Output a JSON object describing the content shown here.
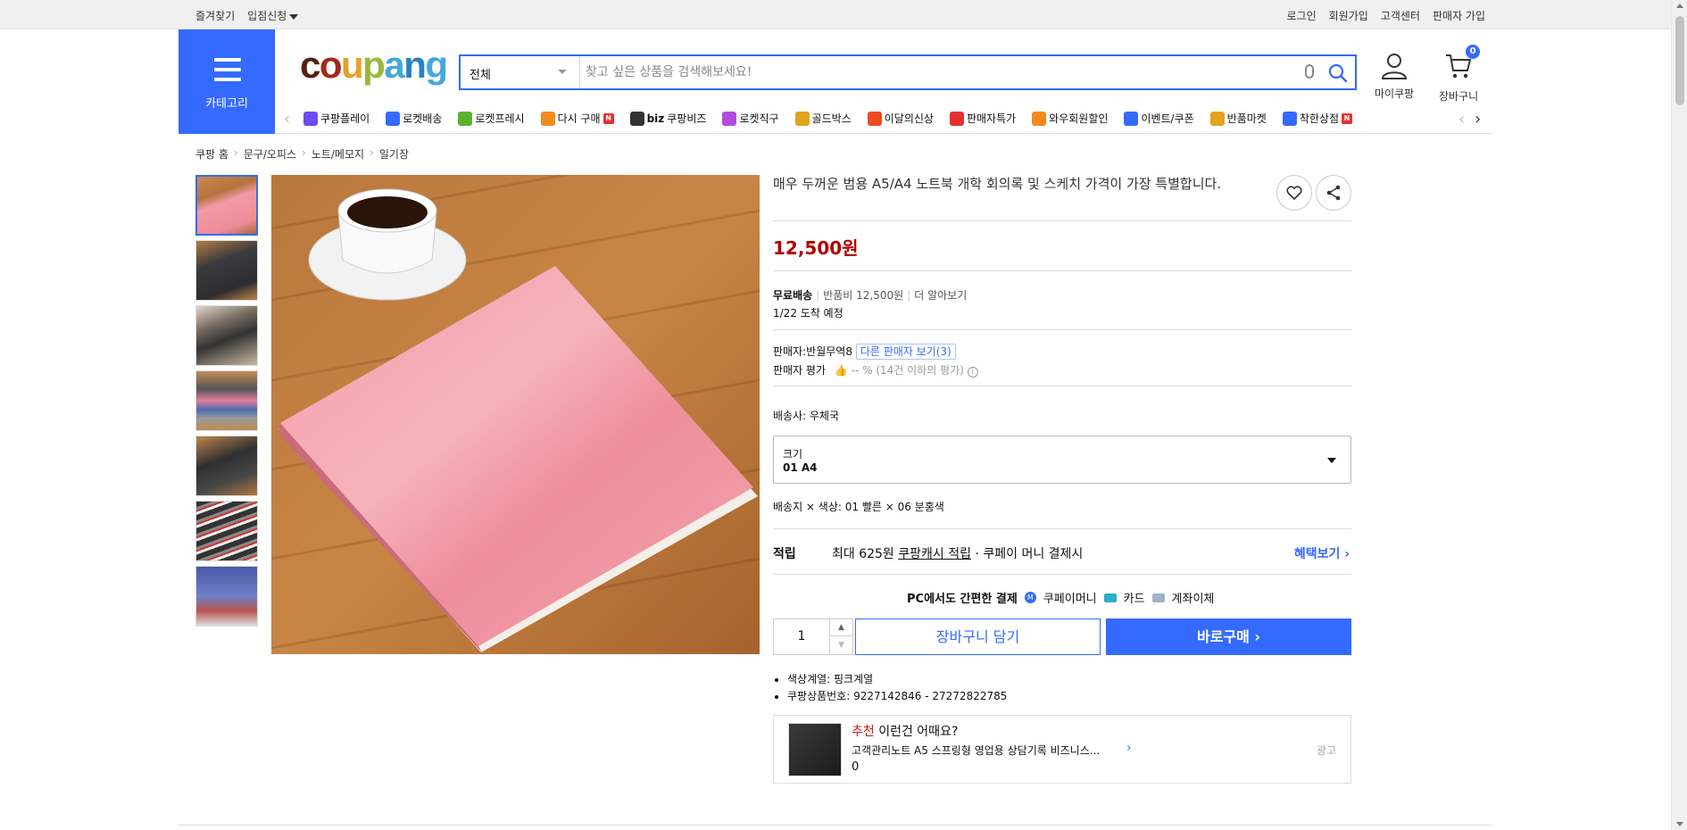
{
  "topbar": {
    "left": [
      "즐겨찾기",
      "입점신청"
    ],
    "right": [
      "로그인",
      "회원가입",
      "고객센터",
      "판매자 가입"
    ]
  },
  "header": {
    "category_label": "카테고리",
    "logo": [
      "c",
      "o",
      "u",
      "p",
      "a",
      "n",
      "g"
    ],
    "search": {
      "category": "전체",
      "placeholder": "찾고 싶은 상품을 검색해보세요!"
    },
    "mycoupang_label": "마이쿠팡",
    "cart_label": "장바구니",
    "cart_count": "0"
  },
  "nav": {
    "items": [
      {
        "label": "쿠팡플레이",
        "icon": "play-icon",
        "color": "#6b4cf6"
      },
      {
        "label": "로켓배송",
        "icon": "rocket-icon",
        "color": "#346aff"
      },
      {
        "label": "로켓프레시",
        "icon": "rocket-fresh-icon",
        "color": "#5ab22f"
      },
      {
        "label": "다시 구매",
        "icon": "rebuy-icon",
        "color": "#f28b1d",
        "badge": "N"
      },
      {
        "label": "쿠팡비즈",
        "prefix": "biz",
        "icon": "biz-icon",
        "color": "#333333"
      },
      {
        "label": "로켓직구",
        "icon": "global-rocket-icon",
        "color": "#b14ce0"
      },
      {
        "label": "골드박스",
        "icon": "goldbox-icon",
        "color": "#e0a41d"
      },
      {
        "label": "이달의신상",
        "icon": "new-icon",
        "color": "#f04a24"
      },
      {
        "label": "판매자특가",
        "icon": "percent-icon",
        "color": "#e5302e"
      },
      {
        "label": "와우회원할인",
        "icon": "wow-icon",
        "color": "#f28b1d"
      },
      {
        "label": "이벤트/쿠폰",
        "icon": "coupon-icon",
        "color": "#346aff"
      },
      {
        "label": "반품마켓",
        "icon": "return-market-icon",
        "color": "#e0a41d"
      },
      {
        "label": "착한상점",
        "icon": "store-icon",
        "color": "#346aff",
        "badge": "N"
      }
    ]
  },
  "breadcrumb": [
    "쿠팡 홈",
    "문구/오피스",
    "노트/메모지",
    "일기장"
  ],
  "product": {
    "title": "매우 두꺼운 범용 A5/A4 노트북 개학 회의록 및 스케치 가격이 가장 특별합니다.",
    "price": "12,500원",
    "shipping": {
      "free": "무료배송",
      "return_fee": "반품비 12,500원",
      "more": "더 알아보기",
      "arrival": "1/22 도착 예정"
    },
    "seller": {
      "label": "판매자:반월무역8",
      "other_sellers": "다른 판매자 보기(3)",
      "rating_label": "판매자 평가",
      "rating_value": "-- % (14건 이하의 평가)"
    },
    "carrier": "배송사:  우체국",
    "option": {
      "label": "크기",
      "value": "01 A4"
    },
    "selected_options": "배송지 × 색상: 01 빨른 × 06 분홍색",
    "reward": {
      "label": "적립",
      "max": "최대 625원",
      "link": "쿠팡캐시 적립",
      "desc": " · 쿠페이 머니 결제시",
      "benefit": "혜택보기"
    },
    "pay": {
      "title": "PC에서도 간편한 결제",
      "methods": [
        "쿠페이머니",
        "카드",
        "계좌이체"
      ]
    },
    "quantity": "1",
    "cart_button": "장바구니 담기",
    "buy_button": "바로구매",
    "details": [
      "색상계열: 핑크계열",
      "쿠팡상품번호: 9227142846 - 27272822785"
    ],
    "recommend": {
      "tag": "추천",
      "title": " 이런건 어때요?",
      "name": "고객관리노트 A5 스프링형 영업용 상담기록 비즈니스...",
      "price": "0",
      "ad": "광고"
    }
  },
  "colors": {
    "accent": "#346aff",
    "price": "#ae0000"
  }
}
